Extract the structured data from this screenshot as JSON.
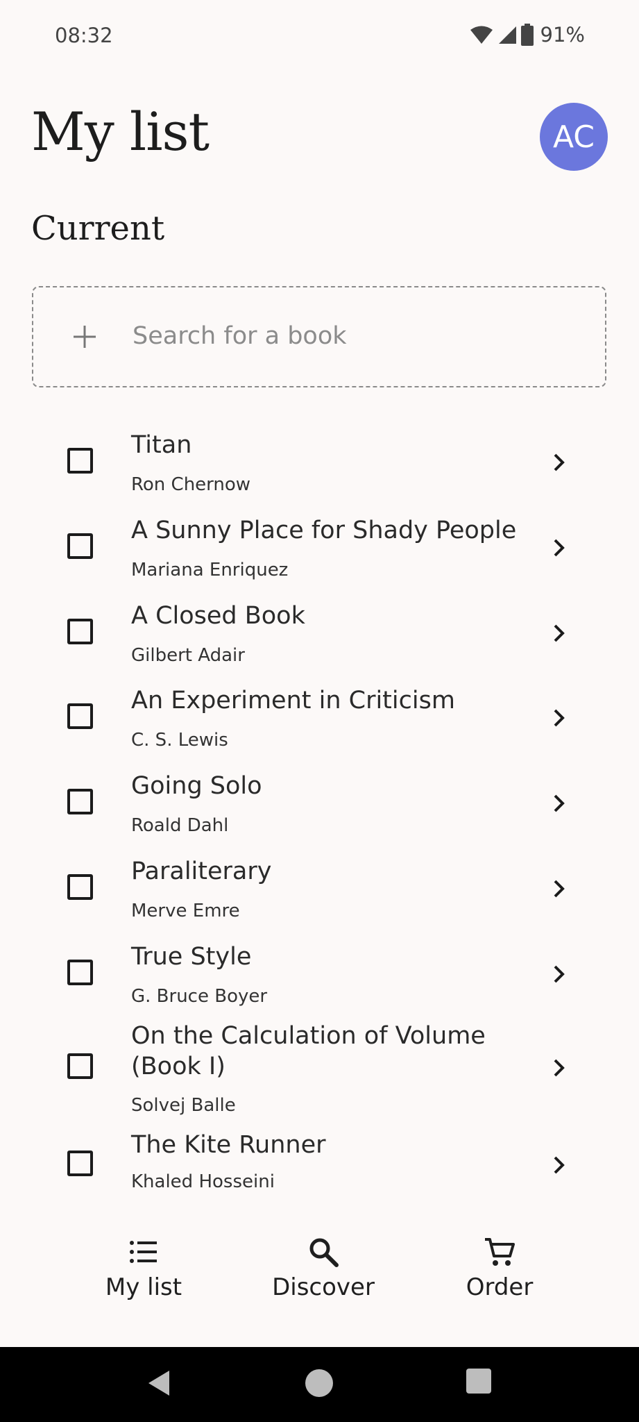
{
  "status": {
    "time": "08:32",
    "battery": "91%",
    "icons": [
      "wifi-icon",
      "signal-icon",
      "battery-icon"
    ]
  },
  "header": {
    "title": "My list",
    "avatar_initials": "AC",
    "avatar_color": "#6b77dd"
  },
  "section": {
    "title": "Current"
  },
  "search": {
    "placeholder": "Search for a book",
    "value": "",
    "icon": "plus-icon"
  },
  "books": [
    {
      "title": "Titan",
      "author": "Ron Chernow"
    },
    {
      "title": "A Sunny Place for Shady People",
      "author": "Mariana Enriquez"
    },
    {
      "title": "A Closed Book",
      "author": "Gilbert Adair"
    },
    {
      "title": "An Experiment in Criticism",
      "author": "C. S. Lewis"
    },
    {
      "title": "Going Solo",
      "author": "Roald Dahl"
    },
    {
      "title": "Paraliterary",
      "author": "Merve Emre"
    },
    {
      "title": "True Style",
      "author": "G. Bruce Boyer"
    },
    {
      "title": "On the Calculation of Volume (Book I)",
      "author": "Solvej Balle"
    },
    {
      "title": "The Kite Runner",
      "author": "Khaled Hosseini"
    }
  ],
  "nav": {
    "items": [
      {
        "label": "My list",
        "icon": "list-icon"
      },
      {
        "label": "Discover",
        "icon": "search-icon"
      },
      {
        "label": "Order",
        "icon": "cart-icon"
      }
    ]
  },
  "system_nav": [
    "back-icon",
    "home-icon",
    "recents-icon"
  ]
}
